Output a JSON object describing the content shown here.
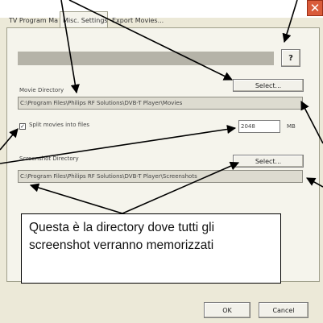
{
  "window": {
    "close_glyph": "✕"
  },
  "tabs": [
    {
      "label": "TV Program Manager",
      "active": false
    },
    {
      "label": "Misc. Settings",
      "active": true
    },
    {
      "label": "Export Movies...",
      "active": false
    }
  ],
  "help_button": {
    "label": "?"
  },
  "movie_directory": {
    "label": "Movie Directory",
    "select_label": "Select...",
    "path": "C:\\Program Files\\Philips RF Solutions\\DVB-T Player\\Movies"
  },
  "split_files": {
    "checkbox_mark": "✓",
    "label": "Split movies into files",
    "size_value": "2048",
    "unit": "MB"
  },
  "screenshot_directory": {
    "label": "Screenshot Directory",
    "select_label": "Select...",
    "path": "C:\\Program Files\\Philips RF Solutions\\DVB-T Player\\Screenshots"
  },
  "callout": {
    "text": "Questa è la directory  dove tutti gli screenshot verranno memorizzati"
  },
  "footer": {
    "ok_label": "OK",
    "cancel_label": "Cancel"
  },
  "colors": {
    "dialog_bg": "#ece9d8",
    "close_button": "#d95b3a",
    "annotation": "#000000"
  }
}
